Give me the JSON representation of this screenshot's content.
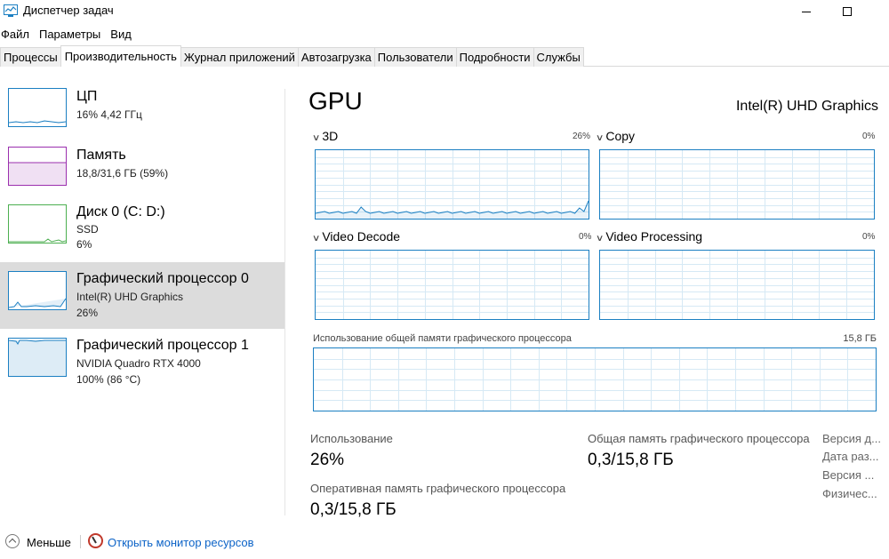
{
  "window": {
    "title": "Диспетчер задач"
  },
  "menu": [
    "Файл",
    "Параметры",
    "Вид"
  ],
  "tabs": [
    {
      "label": "Процессы",
      "active": false
    },
    {
      "label": "Производительность",
      "active": true
    },
    {
      "label": "Журнал приложений",
      "active": false
    },
    {
      "label": "Автозагрузка",
      "active": false
    },
    {
      "label": "Пользователи",
      "active": false
    },
    {
      "label": "Подробности",
      "active": false
    },
    {
      "label": "Службы",
      "active": false
    }
  ],
  "sidebar": [
    {
      "title": "ЦП",
      "line1": "16% 4,42 ГГц",
      "line2": "",
      "color": "#1b7fc2",
      "usage": 0.16
    },
    {
      "title": "Память",
      "line1": "18,8/31,6 ГБ (59%)",
      "line2": "",
      "color": "#9b2fae",
      "usage": 0.59
    },
    {
      "title": "Диск 0 (C: D:)",
      "line1": "SSD",
      "line2": "6%",
      "color": "#4caf50",
      "usage": 0.06
    },
    {
      "title": "Графический процессор 0",
      "line1": "Intel(R) UHD Graphics",
      "line2": "26%",
      "color": "#1b7fc2",
      "usage": 0.26,
      "selected": true
    },
    {
      "title": "Графический процессор 1",
      "line1": "NVIDIA Quadro RTX 4000",
      "line2": "100% (86 °C)",
      "color": "#1b7fc2",
      "usage": 1.0
    }
  ],
  "main": {
    "title": "GPU",
    "adapter": "Intel(R) UHD Graphics",
    "graphs": [
      {
        "label": "3D",
        "pct": "26%"
      },
      {
        "label": "Copy",
        "pct": "0%"
      },
      {
        "label": "Video Decode",
        "pct": "0%"
      },
      {
        "label": "Video Processing",
        "pct": "0%"
      }
    ],
    "shared_memory": {
      "label": "Использование общей памяти графического процессора",
      "max": "15,8 ГБ"
    },
    "stats": {
      "usage_label": "Использование",
      "usage_value": "26%",
      "shared_label": "Общая память графического процессора",
      "shared_value": "0,3/15,8 ГБ",
      "dedicated_label": "Оперативная память графического процессора",
      "dedicated_value": "0,3/15,8 ГБ"
    },
    "info_labels": [
      "Версия д...",
      "Дата раз...",
      "Версия ...",
      "Физичес..."
    ]
  },
  "footer": {
    "fewer_label": "Меньше",
    "resmon_label": "Открыть монитор ресурсов"
  },
  "colors": {
    "accent": "#1b7fc2",
    "link": "#0c63c7"
  }
}
